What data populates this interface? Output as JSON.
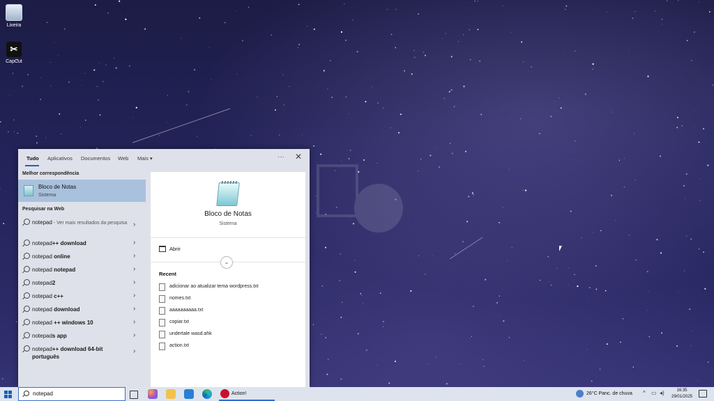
{
  "desktop": {
    "icons": [
      {
        "label": "Lixeira",
        "icon": "recycle-bin-icon"
      },
      {
        "label": "CapCut",
        "icon": "capcut-icon"
      }
    ]
  },
  "search_panel": {
    "tabs": [
      {
        "label": "Tudo",
        "active": true
      },
      {
        "label": "Aplicativos"
      },
      {
        "label": "Documentos"
      },
      {
        "label": "Web"
      },
      {
        "label": "Mais ▾"
      }
    ],
    "more_options": "···",
    "close": "✕",
    "best_match_title": "Melhor correspondência",
    "best_match": {
      "name": "Bloco de Notas",
      "type": "Sistema"
    },
    "web_title": "Pesquisar na Web",
    "web_results": [
      {
        "prefix": "notepad",
        "bold": "",
        "suffix": " - Ver mais resultados da pesquisa"
      },
      {
        "prefix": "notepad",
        "bold": "++ download",
        "suffix": ""
      },
      {
        "prefix": "notepad",
        "bold": " online",
        "suffix": ""
      },
      {
        "prefix": "notepad",
        "bold": " notepad",
        "suffix": ""
      },
      {
        "prefix": "notepad",
        "bold": "2",
        "suffix": ""
      },
      {
        "prefix": "notepad",
        "bold": " c++",
        "suffix": ""
      },
      {
        "prefix": "notepad",
        "bold": " download",
        "suffix": ""
      },
      {
        "prefix": "notepad",
        "bold": " ++ windows 10",
        "suffix": ""
      },
      {
        "prefix": "notepad",
        "bold": "s app",
        "suffix": ""
      },
      {
        "prefix": "notepad",
        "bold": "++ download 64-bit português",
        "suffix": ""
      }
    ],
    "detail": {
      "title": "Bloco de Notas",
      "subtitle": "Sistema",
      "open_label": "Abrir",
      "recent_label": "Recent",
      "recent_files": [
        "adicionar ao atualizar tema wordpress.txt",
        "nomes.txt",
        "aaaaaaaaaa.txt",
        "copiar.txt",
        "undertale wasd.ahk",
        "action.txt"
      ]
    }
  },
  "taskbar": {
    "search_value": "notepad",
    "app_label": "Action!",
    "weather": "26°C  Panc. de chuva",
    "time": "16:35",
    "date": "29/01/2025",
    "accent": "#2f6ed0"
  }
}
